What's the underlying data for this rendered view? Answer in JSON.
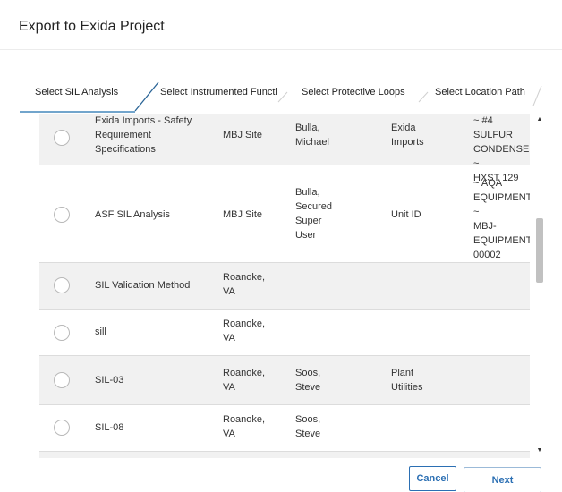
{
  "dialog": {
    "title": "Export to Exida Project"
  },
  "steps": [
    {
      "label": "Select SIL Analysis",
      "active": true
    },
    {
      "label": "Select Instrumented Functio..."
    },
    {
      "label": "Select Protective Loops"
    },
    {
      "label": "Select Location Path"
    }
  ],
  "rows": [
    {
      "name": [
        "Exida Imports - Safety",
        "Requirement",
        "Specifications"
      ],
      "site": [
        "MBJ Site"
      ],
      "owner": [
        "Bulla,",
        "Michael"
      ],
      "unit": [
        "Exida",
        "Imports"
      ],
      "location": [
        "~ #4 SULFUR",
        "CONDENSER ~",
        "HXST 129"
      ]
    },
    {
      "name": [
        "ASF SIL Analysis"
      ],
      "site": [
        "MBJ Site"
      ],
      "owner": [
        "Bulla,",
        "Secured",
        "Super",
        "User"
      ],
      "unit": [
        "Unit ID"
      ],
      "location": [
        "~ AQA",
        "EQUIPMENT ~",
        "MBJ-",
        "EQUIPMENT-",
        "00002"
      ]
    },
    {
      "name": [
        "SIL Validation Method"
      ],
      "site": [
        "Roanoke,",
        "VA"
      ],
      "owner": [],
      "unit": [],
      "location": []
    },
    {
      "name": [
        "sill"
      ],
      "site": [
        "Roanoke,",
        "VA"
      ],
      "owner": [],
      "unit": [],
      "location": []
    },
    {
      "name": [
        "SIL-03"
      ],
      "site": [
        "Roanoke,",
        "VA"
      ],
      "owner": [
        "Soos,",
        "Steve"
      ],
      "unit": [
        "Plant",
        "Utilities"
      ],
      "location": []
    },
    {
      "name": [
        "SIL-08"
      ],
      "site": [
        "Roanoke,",
        "VA"
      ],
      "owner": [
        "Soos,",
        "Steve"
      ],
      "unit": [],
      "location": []
    }
  ],
  "scrollbar": {
    "position_fraction": 0.29
  },
  "footer": {
    "cancel_label": "Cancel",
    "next_label": "Next"
  },
  "colors": {
    "accent": "#2b6fb3",
    "step_underline": "#1f6fae",
    "row_alt": "#f1f1f1"
  }
}
